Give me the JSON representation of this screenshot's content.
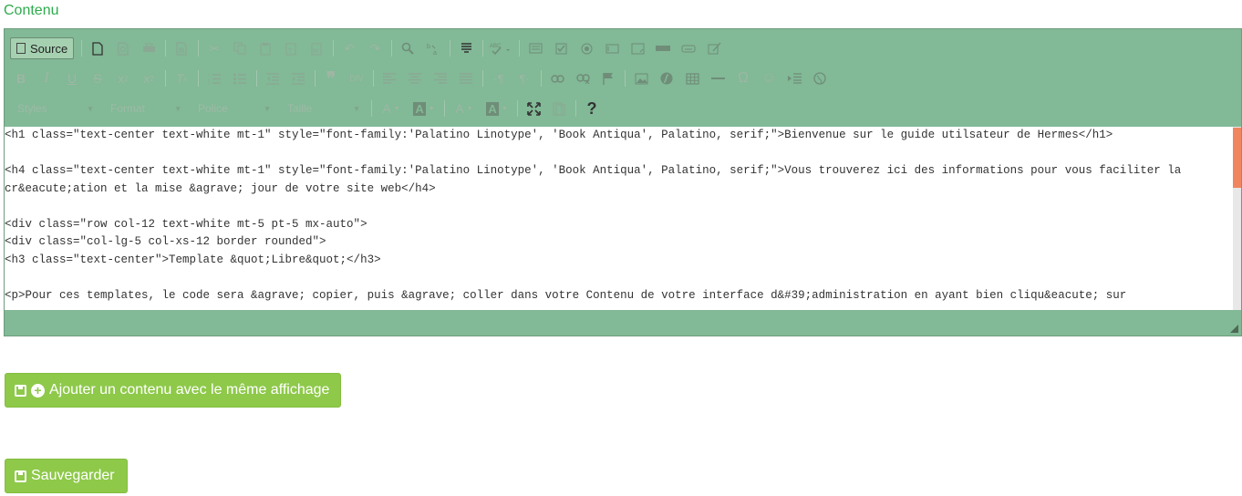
{
  "field_label": "Contenu",
  "toolbar": {
    "source_label": "Source",
    "combos": [
      "Styles",
      "Format",
      "Police",
      "Taille"
    ],
    "help_label": "?"
  },
  "content_lines": [
    "<h1 class=\"text-center text-white mt-1\" style=\"font-family:'Palatino Linotype', 'Book Antiqua', Palatino, serif;\">Bienvenue sur le guide utilsateur de Hermes</h1>",
    "",
    "<h4 class=\"text-center text-white mt-1\" style=\"font-family:'Palatino Linotype', 'Book Antiqua', Palatino, serif;\">Vous trouverez ici des informations pour vous faciliter la",
    "cr&eacute;ation et la mise &agrave; jour de votre site web</h4>",
    "",
    "<div class=\"row col-12 text-white mt-5 pt-5 mx-auto\">",
    "<div class=\"col-lg-5 col-xs-12 border rounded\">",
    "<h3 class=\"text-center\">Template &quot;Libre&quot;</h3>",
    "",
    "<p>Pour ces templates, le code sera &agrave; copier, puis &agrave; coller dans votre Contenu de votre interface d&#39;administration en ayant bien cliqu&eacute; sur"
  ],
  "buttons": {
    "add_label": "Ajouter un contenu avec le même affichage",
    "save_label": "Sauvegarder"
  },
  "colors": {
    "editor_bg": "#82b996",
    "button_bg": "#8ec94a",
    "label_color": "#2eab4d",
    "scroll_thumb": "#ef8660"
  }
}
